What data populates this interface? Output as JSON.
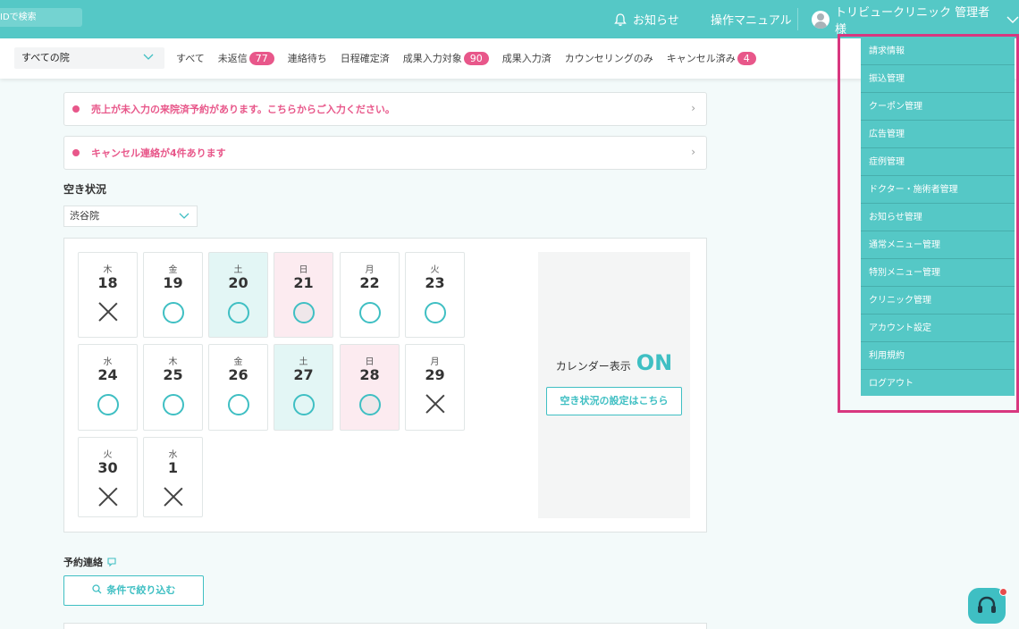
{
  "header": {
    "search_placeholder": "IDで検索",
    "notice": "お知らせ",
    "manual": "操作マニュアル",
    "user": "トリビュークリニック 管理者様"
  },
  "filter": {
    "clinic_select": "すべての院",
    "tabs": [
      {
        "label": "すべて",
        "badge": ""
      },
      {
        "label": "未返信",
        "badge": "77"
      },
      {
        "label": "連絡待ち",
        "badge": ""
      },
      {
        "label": "日程確定済",
        "badge": ""
      },
      {
        "label": "成果入力対象",
        "badge": "90"
      },
      {
        "label": "成果入力済",
        "badge": ""
      },
      {
        "label": "カウンセリングのみ",
        "badge": ""
      },
      {
        "label": "キャンセル済み",
        "badge": "4"
      }
    ]
  },
  "alerts": {
    "sales": "売上が未入力の来院済予約があります。こちらからご入力ください。",
    "cancel": "キャンセル連絡が4件あります"
  },
  "availability": {
    "title": "空き状況",
    "clinic": "渋谷院",
    "days": [
      {
        "dow": "木",
        "date": "18",
        "status": "full",
        "type": "weekday"
      },
      {
        "dow": "金",
        "date": "19",
        "status": "open",
        "type": "weekday"
      },
      {
        "dow": "土",
        "date": "20",
        "status": "open",
        "type": "sat"
      },
      {
        "dow": "日",
        "date": "21",
        "status": "open",
        "type": "sun"
      },
      {
        "dow": "月",
        "date": "22",
        "status": "open",
        "type": "weekday"
      },
      {
        "dow": "火",
        "date": "23",
        "status": "open",
        "type": "weekday"
      },
      {
        "dow": "水",
        "date": "24",
        "status": "open",
        "type": "weekday"
      },
      {
        "dow": "木",
        "date": "25",
        "status": "open",
        "type": "weekday"
      },
      {
        "dow": "金",
        "date": "26",
        "status": "open",
        "type": "weekday"
      },
      {
        "dow": "土",
        "date": "27",
        "status": "open",
        "type": "sat"
      },
      {
        "dow": "日",
        "date": "28",
        "status": "open",
        "type": "sun"
      },
      {
        "dow": "月",
        "date": "29",
        "status": "full",
        "type": "weekday"
      },
      {
        "dow": "火",
        "date": "30",
        "status": "full",
        "type": "weekday"
      },
      {
        "dow": "水",
        "date": "1",
        "status": "full",
        "type": "weekday"
      }
    ],
    "calendar_label": "カレンダー表示",
    "calendar_value": "ON",
    "settings_button": "空き状況の設定はこちら"
  },
  "reservations": {
    "title": "予約連絡",
    "filter_button": "条件で絞り込む"
  },
  "menu": {
    "items": [
      "請求情報",
      "振込管理",
      "クーポン管理",
      "広告管理",
      "症例管理",
      "ドクター・施術者管理",
      "お知らせ管理",
      "通常メニュー管理",
      "特別メニュー管理",
      "クリニック管理",
      "アカウント設定",
      "利用規約",
      "ログアウト"
    ]
  },
  "colors": {
    "brand": "#55c8c6",
    "accent_pink": "#e8578a",
    "highlight": "#d8377f"
  }
}
